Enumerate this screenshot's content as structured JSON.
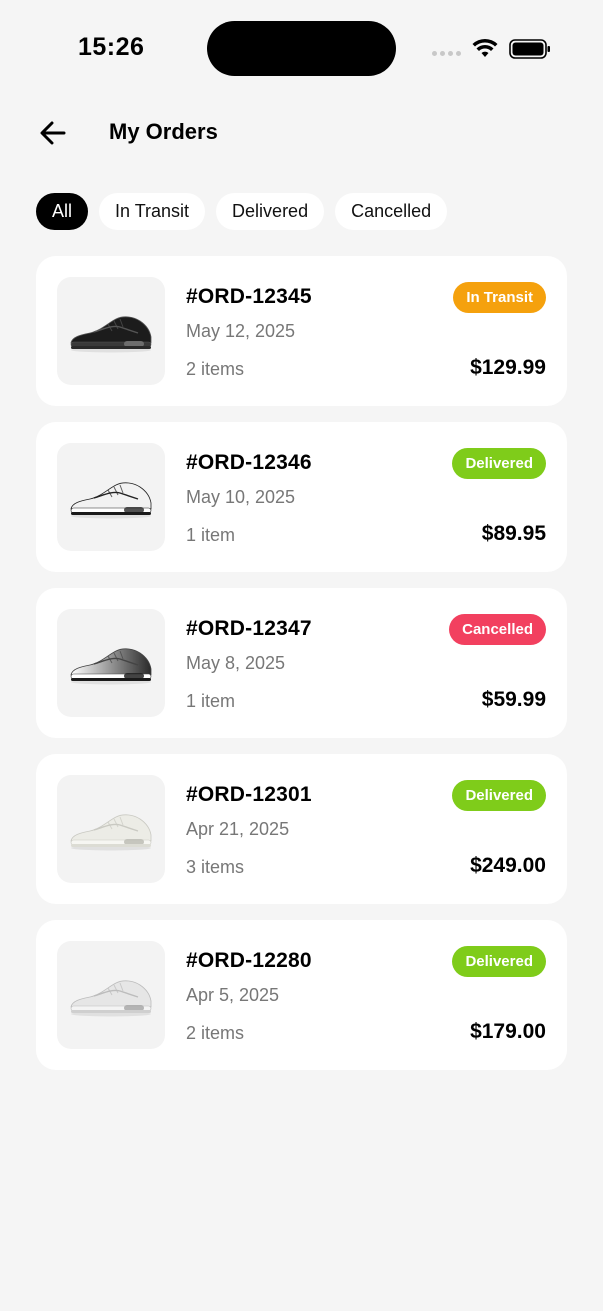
{
  "status_bar": {
    "time": "15:26"
  },
  "header": {
    "title": "My Orders",
    "back_icon": "arrow-left-icon"
  },
  "filters": [
    {
      "label": "All",
      "active": true
    },
    {
      "label": "In Transit",
      "active": false
    },
    {
      "label": "Delivered",
      "active": false
    },
    {
      "label": "Cancelled",
      "active": false
    }
  ],
  "status_colors": {
    "In Transit": "#f5a10d",
    "Delivered": "#7fcc1a",
    "Cancelled": "#f2405f"
  },
  "orders": [
    {
      "id": "#ORD-12345",
      "date": "May 12, 2025",
      "items": "2 items",
      "price": "$129.99",
      "status": "In Transit",
      "shoe": "black-sneaker"
    },
    {
      "id": "#ORD-12346",
      "date": "May 10, 2025",
      "items": "1 item",
      "price": "$89.95",
      "status": "Delivered",
      "shoe": "white-black-sneaker"
    },
    {
      "id": "#ORD-12347",
      "date": "May 8, 2025",
      "items": "1 item",
      "price": "$59.99",
      "status": "Cancelled",
      "shoe": "gradient-sneaker"
    },
    {
      "id": "#ORD-12301",
      "date": "Apr 21, 2025",
      "items": "3 items",
      "price": "$249.00",
      "status": "Delivered",
      "shoe": "cream-sneaker"
    },
    {
      "id": "#ORD-12280",
      "date": "Apr 5, 2025",
      "items": "2 items",
      "price": "$179.00",
      "status": "Delivered",
      "shoe": "light-grey-sneaker"
    }
  ]
}
